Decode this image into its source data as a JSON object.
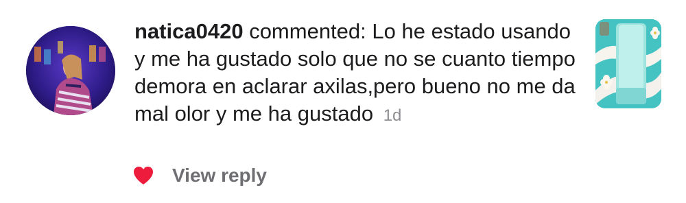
{
  "comment": {
    "username": "natica0420",
    "action": "commented:",
    "text": "Lo he estado usando y me ha gustado solo que no se cuanto tiempo demora en aclarar axilas,pero bueno no me da mal olor y me ha gustado",
    "time": "1d"
  },
  "actions": {
    "like_icon": "heart-icon",
    "liked": true,
    "view_reply_label": "View reply"
  },
  "colors": {
    "heart": "#ed1c3c",
    "secondary_text": "#8e8e93",
    "view_reply": "#6e6e73"
  },
  "icons": {
    "avatar": "user-avatar-photo",
    "post_thumbnail": "post-thumbnail-photo"
  }
}
